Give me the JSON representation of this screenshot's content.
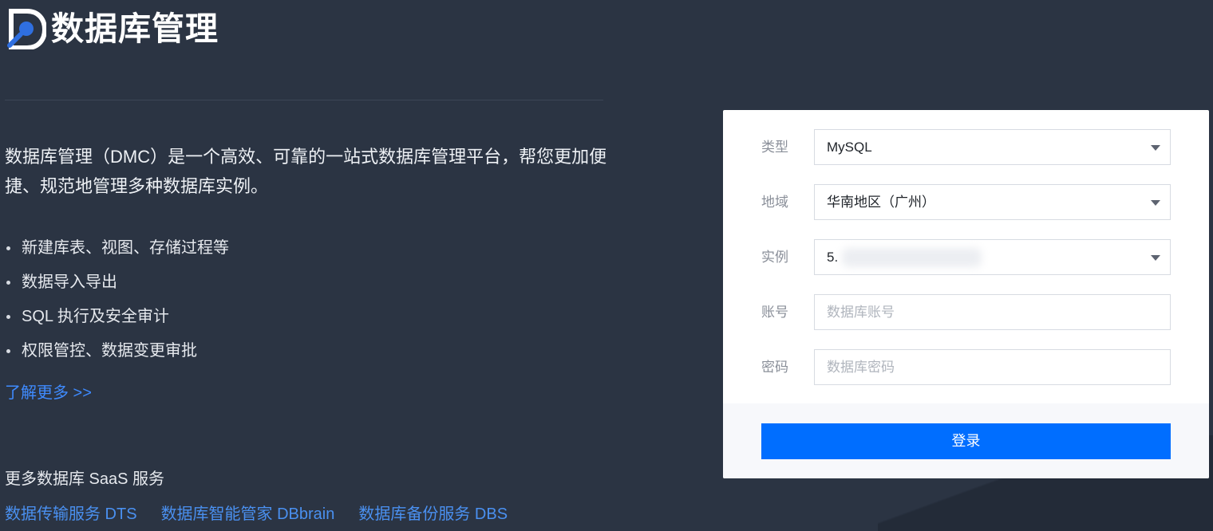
{
  "header": {
    "title": "数据库管理"
  },
  "intro": {
    "text": "数据库管理（DMC）是一个高效、可靠的一站式数据库管理平台，帮您更加便捷、规范地管理多种数据库实例。"
  },
  "features": [
    "新建库表、视图、存储过程等",
    "数据导入导出",
    "SQL 执行及安全审计",
    "权限管控、数据变更审批"
  ],
  "learn_more": "了解更多 >>",
  "more_services": {
    "title": "更多数据库 SaaS 服务",
    "links": [
      "数据传输服务 DTS",
      "数据库智能管家 DBbrain",
      "数据库备份服务 DBS"
    ]
  },
  "login_form": {
    "type": {
      "label": "类型",
      "value": "MySQL"
    },
    "region": {
      "label": "地域",
      "value": "华南地区（广州）"
    },
    "instance": {
      "label": "实例",
      "value": "5."
    },
    "account": {
      "label": "账号",
      "placeholder": "数据库账号"
    },
    "password": {
      "label": "密码",
      "placeholder": "数据库密码"
    },
    "submit_label": "登录"
  },
  "colors": {
    "background": "#2b3443",
    "accent": "#006eff",
    "link": "#3f8bff"
  },
  "icons": {
    "logo": "dmc-logo-icon",
    "dropdown": "caret-down-icon"
  }
}
